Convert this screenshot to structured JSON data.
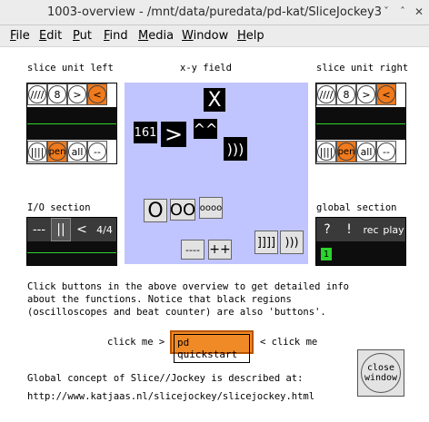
{
  "window": {
    "title": "1003-overview - /mnt/data/puredata/pd-kat/SliceJockey3",
    "controls": {
      "minimize": "ˇ",
      "maximize": "ˆ",
      "close": "✕"
    }
  },
  "menu": {
    "items": [
      {
        "label": "File"
      },
      {
        "label": "Edit"
      },
      {
        "label": "Put"
      },
      {
        "label": "Find"
      },
      {
        "label": "Media"
      },
      {
        "label": "Window"
      },
      {
        "label": "Help"
      }
    ]
  },
  "sections": {
    "slice_left": "slice unit left",
    "xy": "x-y field",
    "slice_right": "slice unit right",
    "io": "I/O section",
    "global": "global section"
  },
  "slice_unit": {
    "top": [
      "////",
      "8",
      ">",
      "<"
    ],
    "bottom": [
      "||||",
      "pen",
      "all",
      "--"
    ]
  },
  "xy_field": {
    "buttons": {
      "x": "X",
      "caret": "^^",
      "num": "161",
      "gt": ">",
      "paren": ")))",
      "o": "O",
      "oo": "OO",
      "oooo": "oooo",
      "dash": "----",
      "plus": "++",
      "bars": "]]]]",
      "paren2": ")))"
    }
  },
  "io": {
    "buttons": [
      "---",
      "||",
      "<",
      "4/4"
    ]
  },
  "global": {
    "buttons": [
      "?",
      "!",
      "rec",
      "play"
    ],
    "counter": "1"
  },
  "text": {
    "info_line1": "Click buttons in the above overview to get detailed info",
    "info_line2": "about the functions. Notice that black regions",
    "info_line3": "(oscilloscopes and beat counter) are also 'buttons'.",
    "click_left": "click me >",
    "quickstart": "pd quickstart",
    "click_right": "< click me",
    "concept": "Global concept of Slice//Jockey is described at:",
    "url": "http://www.katjaas.nl/slicejockey/slicejockey.html"
  },
  "close_window": {
    "line1": "close",
    "line2": "window"
  },
  "colors": {
    "accent_orange": "#f07a1c",
    "xy_background": "#c0c4ff",
    "scope_green": "#2bd42b"
  }
}
